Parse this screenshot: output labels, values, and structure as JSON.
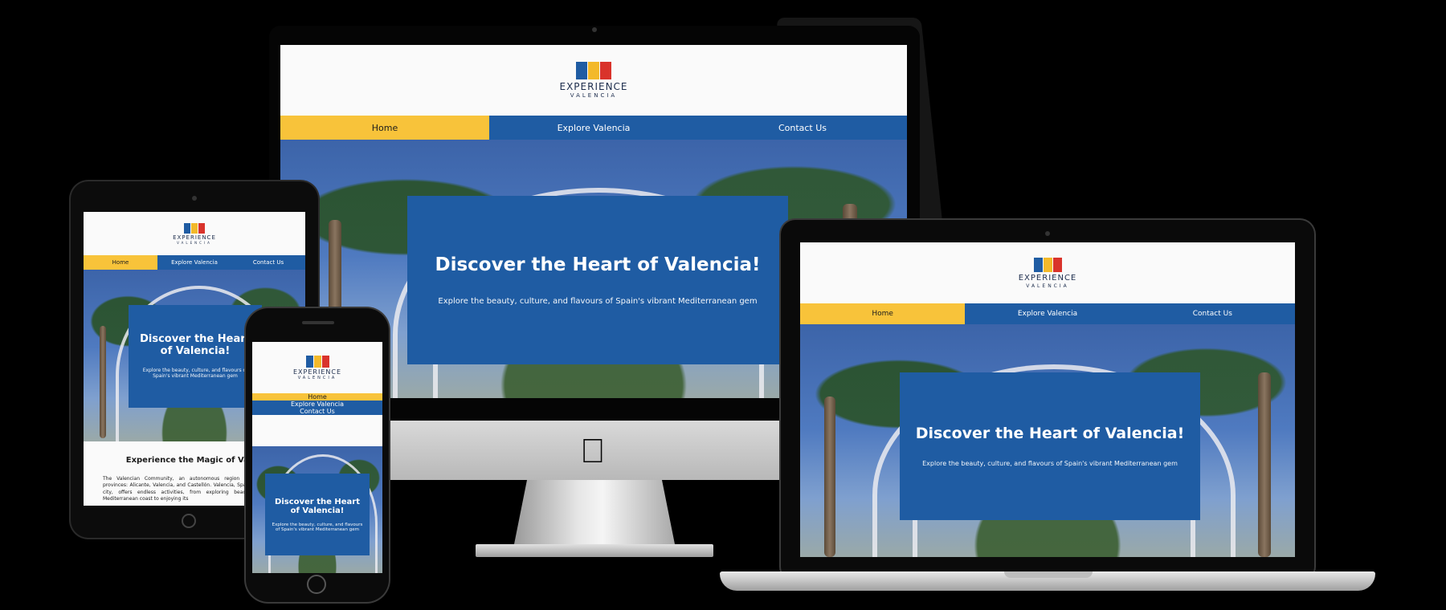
{
  "site": {
    "logo_title": "EXPERIENCE",
    "logo_sub": "VALENCIA",
    "nav": [
      {
        "label": "Home",
        "active": true
      },
      {
        "label": "Explore Valencia",
        "active": false
      },
      {
        "label": "Contact Us",
        "active": false
      }
    ],
    "hero_title": "Discover the Heart of Valencia!",
    "hero_subtitle": "Explore the beauty, culture, and flavours of Spain's vibrant Mediterranean gem",
    "tablet_section_title": "Experience the Magic of Valen",
    "tablet_section_text": "The Valencian Community, an autonomous region in Spain, three provinces: Alicante, Valencia, and Castellón. Valencia, Spain's third-largest city, offers endless activities, from exploring beaches along the Mediterranean coast to enjoying its"
  },
  "colors": {
    "brand_blue": "#1f5ca3",
    "brand_yellow": "#f8c33a",
    "brand_red": "#d9332b",
    "background": "#000000"
  },
  "icons": [
    "apple-logo-icon",
    "camera-icon",
    "home-button-icon"
  ]
}
